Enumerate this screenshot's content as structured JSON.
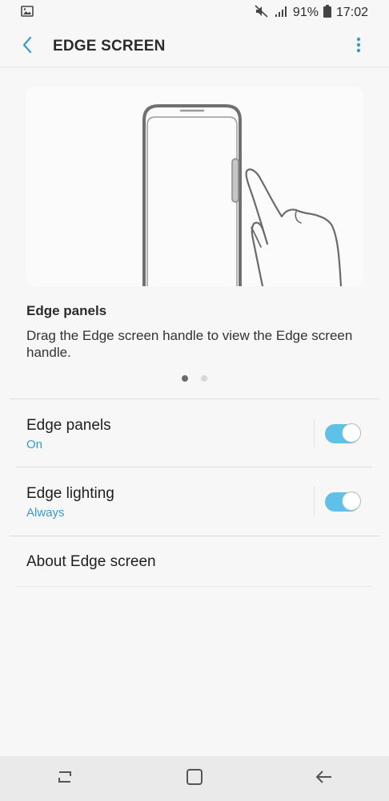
{
  "status_bar": {
    "battery": "91%",
    "time": "17:02"
  },
  "app_bar": {
    "title": "EDGE SCREEN"
  },
  "card": {
    "title": "Edge panels",
    "description": "Drag the Edge screen handle to view the Edge screen handle.",
    "pager_total": 2,
    "pager_active": 1
  },
  "settings": [
    {
      "title": "Edge panels",
      "subtitle": "On",
      "toggle_on": true
    },
    {
      "title": "Edge lighting",
      "subtitle": "Always",
      "toggle_on": true
    },
    {
      "title": "About Edge screen"
    }
  ],
  "colors": {
    "accent": "#3a9bc7",
    "toggle_on": "#5fc0e8"
  },
  "icons": [
    "image-icon",
    "mute-icon",
    "signal-icon",
    "battery-icon",
    "back-arrow-icon",
    "more-vert-icon",
    "recents-icon",
    "home-icon",
    "nav-back-icon"
  ]
}
